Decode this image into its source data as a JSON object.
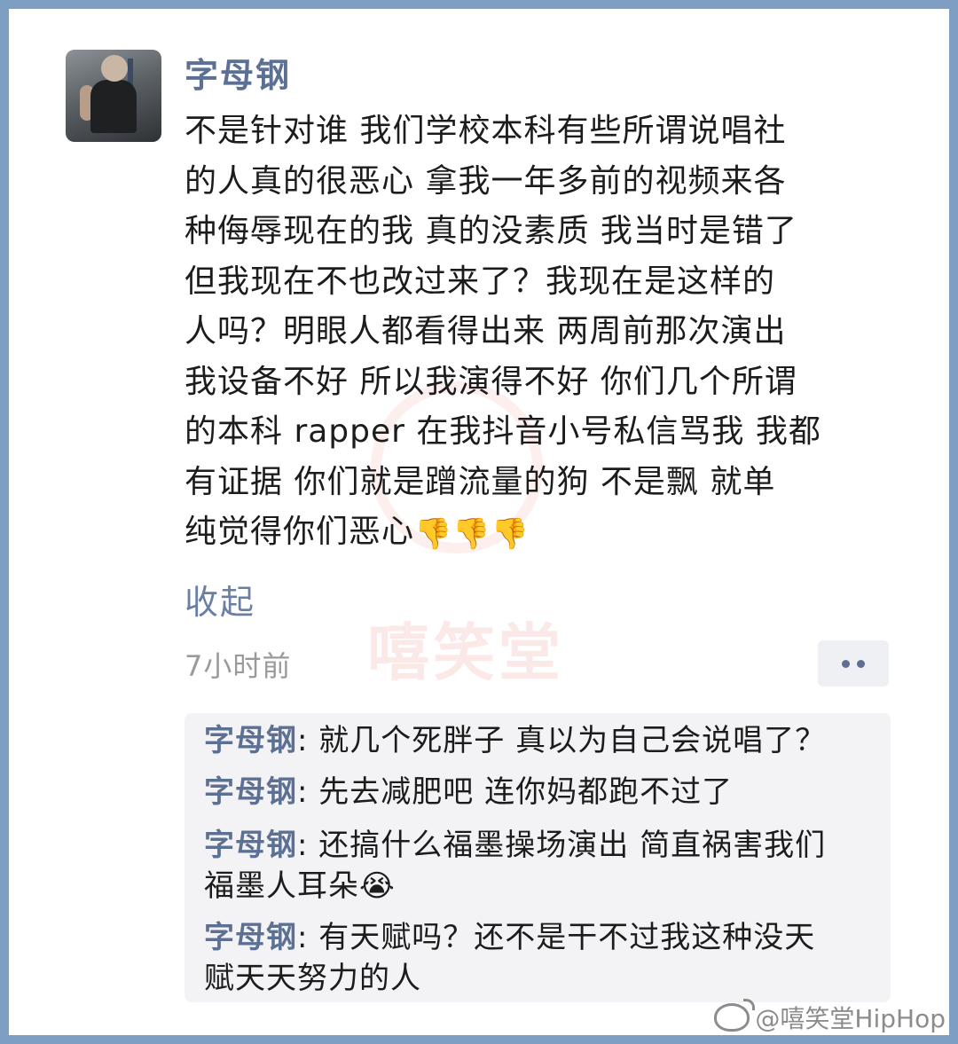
{
  "post": {
    "author": "字母钢",
    "lines": [
      "不是针对谁 我们学校本科有些所谓说唱社",
      "的人真的很恶心 拿我一年多前的视频来各",
      "种侮辱现在的我 真的没素质 我当时是错了",
      " 但我现在不也改过来了？我现在是这样的",
      "人吗？明眼人都看得出来 两周前那次演出",
      "我设备不好 所以我演得不好 你们几个所谓",
      "的本科 rapper 在我抖音小号私信骂我 我都",
      "有证据 你们就是蹭流量的狗 不是飘 就单"
    ],
    "last_line": "纯觉得你们恶心",
    "emoji": "👎👎👎",
    "collapse_label": "收起",
    "time": "7小时前"
  },
  "comments": [
    {
      "author": "字母钢",
      "lines": [
        ": 就几个死胖子 真以为自己会说唱了？"
      ]
    },
    {
      "author": "字母钢",
      "lines": [
        ": 先去减肥吧 连你妈都跑不过了"
      ]
    },
    {
      "author": "字母钢",
      "lines": [
        ": 还搞什么福墨操场演出 简直祸害我们",
        "福墨人耳朵😭"
      ]
    },
    {
      "author": "字母钢",
      "lines": [
        ": 有天赋吗？还不是干不过我这种没天",
        "赋天天努力的人"
      ]
    }
  ],
  "watermark": {
    "text": "嘻笑堂",
    "handle": "@嘻笑堂HipHop"
  },
  "colors": {
    "border": "#7f9ec4",
    "name": "#5c7093",
    "text": "#1c1c1c",
    "muted": "#9a9a9a"
  }
}
